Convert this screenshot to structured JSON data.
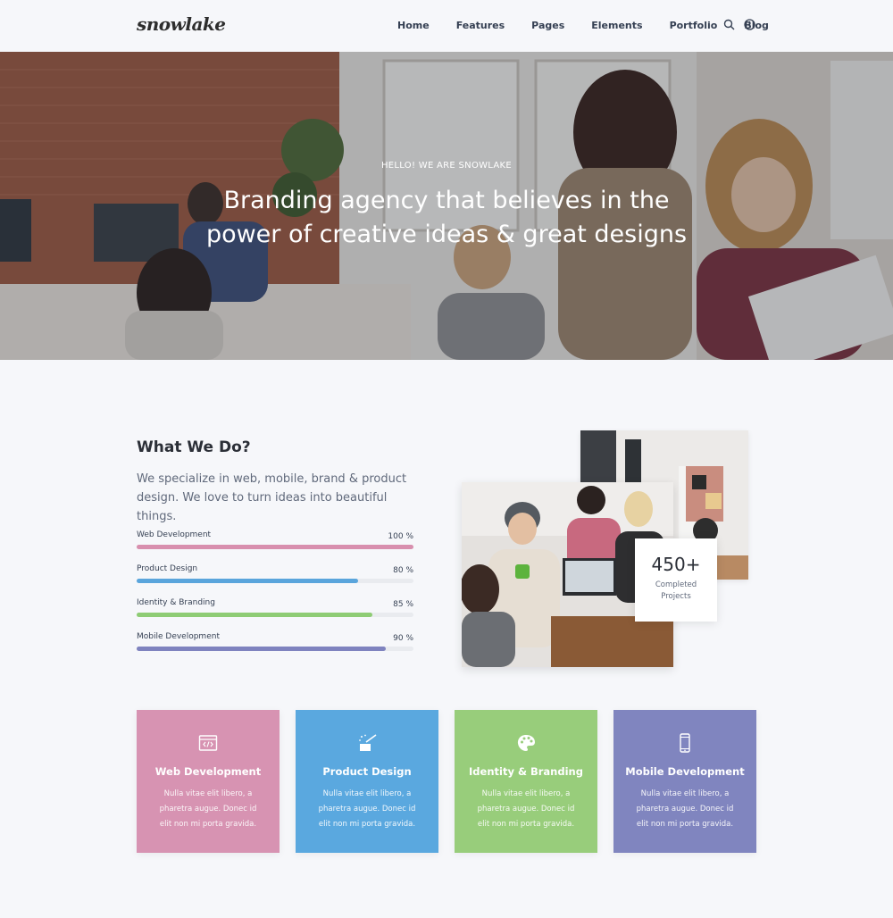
{
  "header": {
    "logo": "snowlake",
    "nav": [
      "Home",
      "Features",
      "Pages",
      "Elements",
      "Portfolio",
      "Blog"
    ],
    "icons": [
      "search-icon",
      "info-icon"
    ]
  },
  "hero": {
    "kicker": "HELLO! WE ARE SNOWLAKE",
    "title_line1": "Branding agency that believes in the",
    "title_line2": "power of creative ideas & great designs"
  },
  "about": {
    "title": "What We Do?",
    "text": "We specialize in web, mobile, brand & product design. We love to turn ideas into beautiful things.",
    "skills": [
      {
        "label": "Web Development",
        "percent_text": "100 %",
        "value": 100,
        "color": "#d88fae"
      },
      {
        "label": "Product Design",
        "percent_text": "80 %",
        "value": 80,
        "color": "#5aa5dc"
      },
      {
        "label": "Identity & Branding",
        "percent_text": "85 %",
        "value": 85,
        "color": "#8ecc74"
      },
      {
        "label": "Mobile Development",
        "percent_text": "90 %",
        "value": 90,
        "color": "#7f83bf"
      }
    ],
    "stat": {
      "number": "450+",
      "label": "Completed Projects"
    }
  },
  "services": [
    {
      "title": "Web Development",
      "text": "Nulla vitae elit libero, a pharetra augue. Donec id elit non mi porta gravida.",
      "color": "#d793b2",
      "icon": "code-window-icon"
    },
    {
      "title": "Product Design",
      "text": "Nulla vitae elit libero, a pharetra augue. Donec id elit non mi porta gravida.",
      "color": "#5aa8df",
      "icon": "magic-wand-icon"
    },
    {
      "title": "Identity & Branding",
      "text": "Nulla vitae elit libero, a pharetra augue. Donec id elit non mi porta gravida.",
      "color": "#98cd7b",
      "icon": "palette-icon"
    },
    {
      "title": "Mobile Development",
      "text": "Nulla vitae elit libero, a pharetra augue. Donec id elit non mi porta gravida.",
      "color": "#8085bf",
      "icon": "smartphone-icon"
    }
  ]
}
